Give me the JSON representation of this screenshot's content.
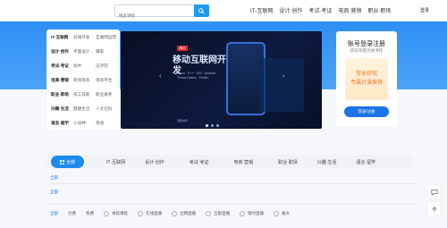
{
  "header": {
    "search_placeholder": "搜索课程",
    "nav": [
      "IT·互联网",
      "设计·创作",
      "考试·考证",
      "电商·营销",
      "职业·职场"
    ],
    "login": "登录"
  },
  "categories": [
    {
      "heading": "IT·互联网",
      "items": [
        "前端开发",
        "互联网运营"
      ]
    },
    {
      "heading": "设计·创作",
      "items": [
        "平面设计...",
        "摄影"
      ]
    },
    {
      "heading": "考试·考证",
      "items": [
        "高中",
        "法学院"
      ]
    },
    {
      "heading": "电商·营销",
      "items": [
        "跨境电商",
        "电商平台"
      ]
    },
    {
      "heading": "职业·职场",
      "items": [
        "技工技能",
        "职业素养"
      ]
    },
    {
      "heading": "兴趣·生活",
      "items": [
        "健康生活",
        "人文社科"
      ]
    },
    {
      "heading": "语言·留学",
      "items": [
        "小语种",
        "英语"
      ]
    }
  ],
  "banner": {
    "tag": "腾讯",
    "title": "移动互联网开发",
    "subtitle_lines": [
      "Java · C++ · iOS · Android",
      "React Native · Flutter"
    ],
    "caption": "课程推荐"
  },
  "login_card": {
    "title": "账号登录注册",
    "subtitle": "获取海量优质课程",
    "promo_lines": [
      "登录获取",
      "专属好课推荐"
    ],
    "button": "登录/注册"
  },
  "tabs": [
    "全部",
    "IT·互联网",
    "设计·创作",
    "考试·考证",
    "电商·营销",
    "职业·职场",
    "兴趣·生活",
    "语言·留学"
  ],
  "filter_link_1": "全部",
  "filter_link_2": "全部",
  "filters": {
    "first": "全部",
    "plain": [
      "付费",
      "免费"
    ],
    "options": [
      "本校课程",
      "在线直播",
      "全网直播",
      "全部直播",
      "限时直播",
      "报文"
    ]
  },
  "colors": {
    "accent": "#1d8af0",
    "promo": "#f27a2c"
  }
}
